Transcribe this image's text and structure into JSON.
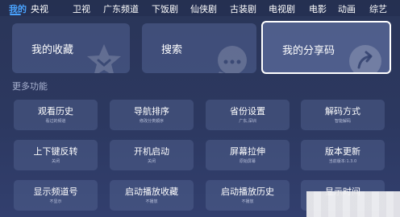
{
  "nav": {
    "tabs": [
      "我的",
      "央视",
      "卫视",
      "广东频道",
      "下饭剧",
      "仙侠剧",
      "古装剧",
      "电视剧",
      "电影",
      "动画",
      "综艺"
    ],
    "active_index": 0,
    "active_color": "#4aa3ff"
  },
  "cards": [
    {
      "label": "我的收藏",
      "icon": "star-icon"
    },
    {
      "label": "搜索",
      "icon": "search-bubble-icon"
    },
    {
      "label": "我的分享码",
      "icon": "share-arrow-icon"
    }
  ],
  "section_title": "更多功能",
  "functions": [
    {
      "title": "观看历史",
      "sub": "看过的频道"
    },
    {
      "title": "导航排序",
      "sub": "修改分类顺序"
    },
    {
      "title": "省份设置",
      "sub": "广东,深圳"
    },
    {
      "title": "解码方式",
      "sub": "智能解码"
    },
    {
      "title": "上下键反转",
      "sub": "关闭"
    },
    {
      "title": "开机启动",
      "sub": "关闭"
    },
    {
      "title": "屏幕拉伸",
      "sub": "原始屏幕"
    },
    {
      "title": "版本更新",
      "sub": "当前版本:1.3.0"
    },
    {
      "title": "显示频道号",
      "sub": "不显示"
    },
    {
      "title": "启动播放收藏",
      "sub": "不播放"
    },
    {
      "title": "启动播放历史",
      "sub": "不播放"
    },
    {
      "title": "显示时间",
      "sub": ""
    }
  ]
}
